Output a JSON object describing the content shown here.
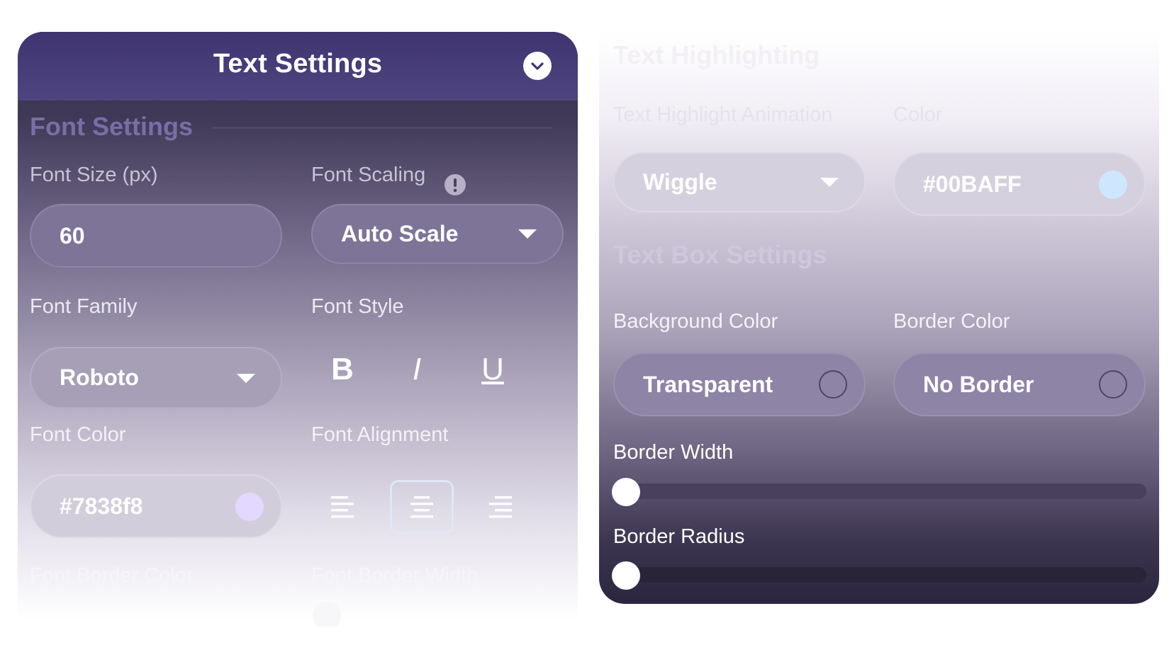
{
  "text_settings": {
    "title": "Text Settings",
    "font_settings_title": "Font Settings",
    "font_size": {
      "label": "Font Size (px)",
      "value": "60"
    },
    "font_scaling": {
      "label": "Font Scaling",
      "value": "Auto Scale"
    },
    "font_family": {
      "label": "Font Family",
      "value": "Roboto"
    },
    "font_style": {
      "label": "Font Style",
      "bold": "B",
      "italic": "I",
      "underline": "U"
    },
    "font_color": {
      "label": "Font Color",
      "value": "#7838f8",
      "swatch": "#e3d8ff"
    },
    "font_alignment": {
      "label": "Font Alignment",
      "selected": "center"
    },
    "font_border_color": {
      "label": "Font Border Color"
    },
    "font_border_width": {
      "label": "Font Border Width"
    }
  },
  "text_highlighting": {
    "title": "Text Highlighting",
    "animation": {
      "label": "Text Highlight Animation",
      "value": "Wiggle"
    },
    "color": {
      "label": "Color",
      "value": "#00BAFF",
      "swatch": "#cfe6ff"
    }
  },
  "text_box_settings": {
    "title": "Text Box Settings",
    "background_color": {
      "label": "Background Color",
      "value": "Transparent"
    },
    "border_color": {
      "label": "Border Color",
      "value": "No Border"
    },
    "border_width": {
      "label": "Border Width",
      "value": 0
    },
    "border_radius": {
      "label": "Border Radius",
      "value": 0
    }
  },
  "colors": {
    "header_purple": "#3f3470",
    "accent_purple": "#7a6ea6",
    "pill_purple": "#7e7498"
  }
}
